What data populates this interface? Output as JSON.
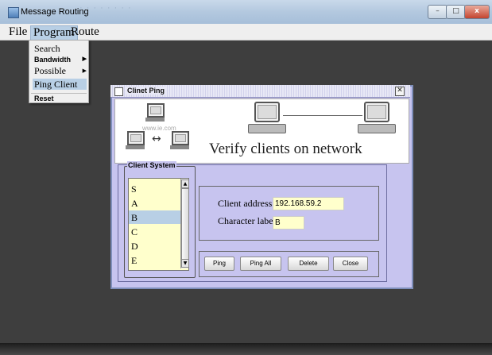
{
  "window": {
    "title": "Message Routing",
    "faded_title_bleed": "· · ·  · · ·  ·  ·",
    "min_glyph": "–",
    "max_glyph": "□",
    "close_glyph": "x"
  },
  "menubar": {
    "items": [
      "File",
      "Program",
      "Route"
    ],
    "active": "Program"
  },
  "dropdown": {
    "items": [
      {
        "label": "Search",
        "submenu": false
      },
      {
        "label": "Bandwidth",
        "submenu": true
      },
      {
        "label": "Possible Route",
        "submenu": true
      },
      {
        "label": "Ping Client",
        "submenu": false,
        "highlighted": true
      },
      {
        "label": "Reset",
        "submenu": false
      }
    ],
    "submenu_arrow": "▶"
  },
  "dialog": {
    "title": "Clinet Ping",
    "close_glyph": "✕",
    "banner_text": "Verify clients on network",
    "watermark": "www.ie.com",
    "arrows": "↔"
  },
  "client_system": {
    "group_label": "Client System",
    "items": [
      "S",
      "A",
      "B",
      "C",
      "D",
      "E"
    ],
    "selected": "B",
    "scroll_up": "▲",
    "scroll_down": "▼"
  },
  "info": {
    "address_label": "Client address",
    "address_value": "192.168.59.2",
    "char_label": "Character label",
    "char_value": "B"
  },
  "buttons": {
    "ping": "Ping",
    "ping_all": "Ping All",
    "delete": "Delete",
    "close": "Close"
  },
  "colors": {
    "dialog_bg": "#c7c4ef",
    "field_bg": "#ffffcc",
    "selection": "#b8cfe5",
    "desktop": "#3e3e3e"
  }
}
